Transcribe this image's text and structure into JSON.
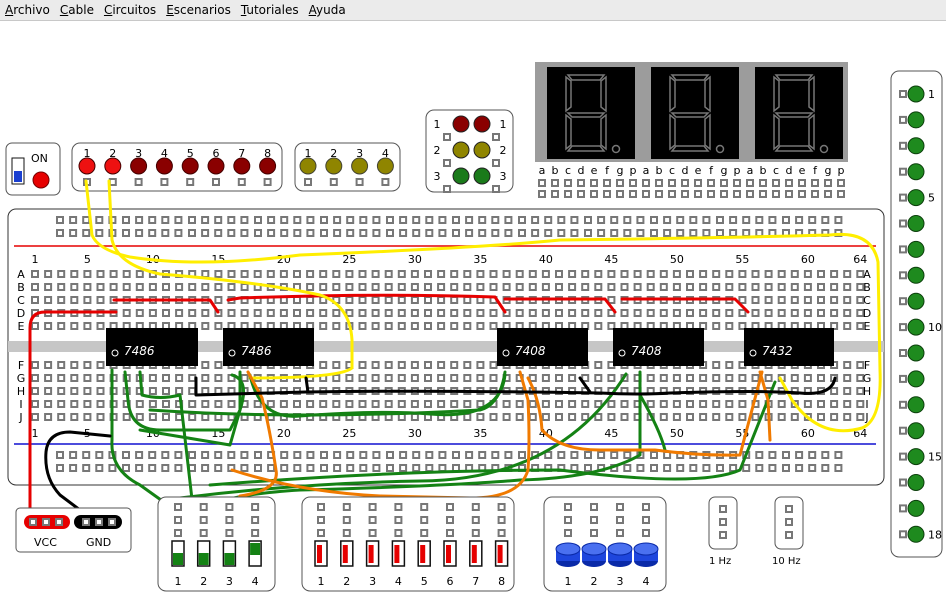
{
  "menu": [
    "Archivo",
    "Cable",
    "Circuitos",
    "Escenarios",
    "Tutoriales",
    "Ayuda"
  ],
  "power_switch": {
    "label": "ON"
  },
  "red_leds": [
    "1",
    "2",
    "3",
    "4",
    "5",
    "6",
    "7",
    "8"
  ],
  "red_leds_on": [
    true,
    true,
    false,
    false,
    false,
    false,
    false,
    false
  ],
  "yellow_leds": [
    "1",
    "2",
    "3",
    "4"
  ],
  "traffic_light": {
    "left": [
      "1",
      "2",
      "3"
    ],
    "right": [
      "1",
      "2",
      "3"
    ]
  },
  "seven_segment": {
    "digits": 3,
    "pins": [
      "a",
      "b",
      "c",
      "d",
      "e",
      "f",
      "g",
      "p"
    ]
  },
  "breadboard": {
    "top_numbers": [
      "1",
      "5",
      "10",
      "15",
      "20",
      "25",
      "30",
      "35",
      "40",
      "45",
      "50",
      "55",
      "60",
      "64"
    ],
    "bottom_numbers": [
      "1",
      "5",
      "10",
      "15",
      "20",
      "25",
      "30",
      "35",
      "40",
      "45",
      "50",
      "55",
      "60",
      "64"
    ],
    "row_labels_top": [
      "A",
      "B",
      "C",
      "D",
      "E"
    ],
    "row_labels_bottom": [
      "F",
      "G",
      "H",
      "I",
      "J"
    ]
  },
  "chips": [
    {
      "label": "7486"
    },
    {
      "label": "7486"
    },
    {
      "label": "7408"
    },
    {
      "label": "7408"
    },
    {
      "label": "7432"
    }
  ],
  "power_terminal": {
    "vcc": "VCC",
    "gnd": "GND"
  },
  "dip_switch_a": [
    "1",
    "2",
    "3",
    "4"
  ],
  "dip_switch_b": [
    "1",
    "2",
    "3",
    "4",
    "5",
    "6",
    "7",
    "8"
  ],
  "push_buttons": [
    "1",
    "2",
    "3",
    "4"
  ],
  "clocks": [
    {
      "label": "1 Hz"
    },
    {
      "label": "10 Hz"
    }
  ],
  "right_leds": [
    "1",
    "",
    "",
    "",
    "5",
    "",
    "",
    "",
    "",
    "10",
    "",
    "",
    "",
    "",
    "15",
    "",
    "",
    "18"
  ],
  "colors": {
    "red": "#e60000",
    "yellow": "#ffee00",
    "green": "#148214",
    "black": "#000000",
    "orange": "#f07a00",
    "blue_rail": "#1010d0"
  }
}
